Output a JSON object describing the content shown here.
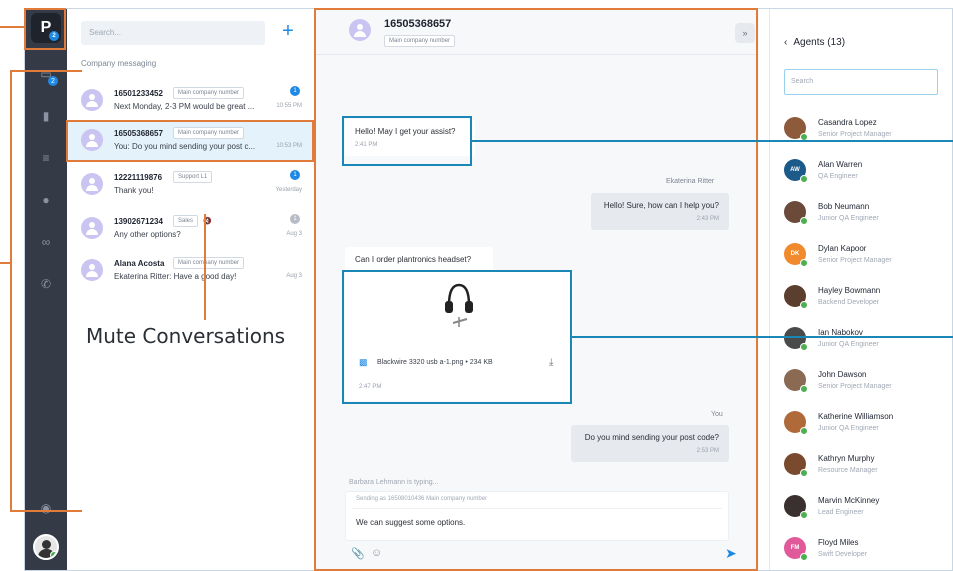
{
  "colors": {
    "accent": "#1e88e5",
    "orange": "#e07b39",
    "teal": "#1b87b7",
    "online": "#4caf50",
    "rail": "#343a46"
  },
  "rail": {
    "logo_letter": "P",
    "logo_badge": "2",
    "icons": [
      "chat-icon",
      "video-icon",
      "list-icon",
      "clock-icon",
      "voicemail-icon",
      "phone-icon",
      "help-icon"
    ],
    "chat_badge": "2"
  },
  "conversations": {
    "search_placeholder": "Search...",
    "add_label": "+",
    "section_label": "Company messaging",
    "items": [
      {
        "number": "16501233452",
        "tag": "Main company number",
        "preview": "Next Monday, 2-3 PM would be great ...",
        "time": "10:55 PM",
        "badge": "1"
      },
      {
        "number": "16505368657",
        "tag": "Main company number",
        "preview": "You: Do you mind sending your post c...",
        "time": "10:53 PM",
        "badge": ""
      },
      {
        "number": "12221119876",
        "tag": "Support L1",
        "preview": "Thank you!",
        "time": "Yesterday",
        "badge": "1"
      },
      {
        "number": "13902671234",
        "tag": "Sales",
        "preview": "Any other options?",
        "time": "Aug 3",
        "badge": "1"
      },
      {
        "number": "Alana Acosta",
        "tag": "Main company number",
        "preview": "Ekaterina Ritter: Have a good day!",
        "time": "Aug 3",
        "badge": ""
      }
    ]
  },
  "chat": {
    "title": "16505368657",
    "subtitle": "Main company number",
    "collapse_label": "»",
    "messages": {
      "m1": {
        "text": "Hello! May I get your assist?",
        "time": "2:41 PM"
      },
      "m2_sender": "Ekaterina Ritter",
      "m2": {
        "text": "Hello! Sure, how can I help you?",
        "time": "2:43 PM"
      },
      "m3": {
        "text": "Can I order plantronics headset?"
      },
      "attachment": {
        "filename": "Blackwire 3320 usb a-1.png",
        "size": "234 KB",
        "time": "2:47 PM"
      },
      "m4_sender": "You",
      "m4": {
        "text": "Do you mind sending your post code?",
        "time": "2:53 PM"
      }
    },
    "typing": "Barbara Lehmann is typing...",
    "composer": {
      "sending_from": "Sending as 16508010436 Main company number",
      "draft": "We can suggest some options."
    }
  },
  "agents": {
    "title": "Agents (13)",
    "search_placeholder": "Search",
    "list": [
      {
        "name": "Casandra Lopez",
        "role": "Senior Project Manager",
        "color": "#8d5a3b",
        "initials": ""
      },
      {
        "name": "Alan Warren",
        "role": "QA Engineer",
        "color": "#1c5a8a",
        "initials": "AW"
      },
      {
        "name": "Bob Neumann",
        "role": "Junior QA Engineer",
        "color": "#6b4a3a",
        "initials": ""
      },
      {
        "name": "Dylan Kapoor",
        "role": "Senior Project Manager",
        "color": "#f08a2c",
        "initials": "DK"
      },
      {
        "name": "Hayley Bowmann",
        "role": "Backend Developer",
        "color": "#5a3e2e",
        "initials": ""
      },
      {
        "name": "Ian Nabokov",
        "role": "Junior QA Engineer",
        "color": "#4a4a4a",
        "initials": ""
      },
      {
        "name": "John Dawson",
        "role": "Senior Project Manager",
        "color": "#8a6a52",
        "initials": ""
      },
      {
        "name": "Katherine Williamson",
        "role": "Junior QA Engineer",
        "color": "#b06a3a",
        "initials": ""
      },
      {
        "name": "Kathryn Murphy",
        "role": "Resource Manager",
        "color": "#7a4a2e",
        "initials": ""
      },
      {
        "name": "Marvin McKinney",
        "role": "Lead Engineer",
        "color": "#3a3030",
        "initials": ""
      },
      {
        "name": "Floyd Miles",
        "role": "Swift Developer",
        "color": "#e05a9a",
        "initials": "FM"
      }
    ]
  },
  "annotation": {
    "mute_label": "Mute Conversations"
  }
}
